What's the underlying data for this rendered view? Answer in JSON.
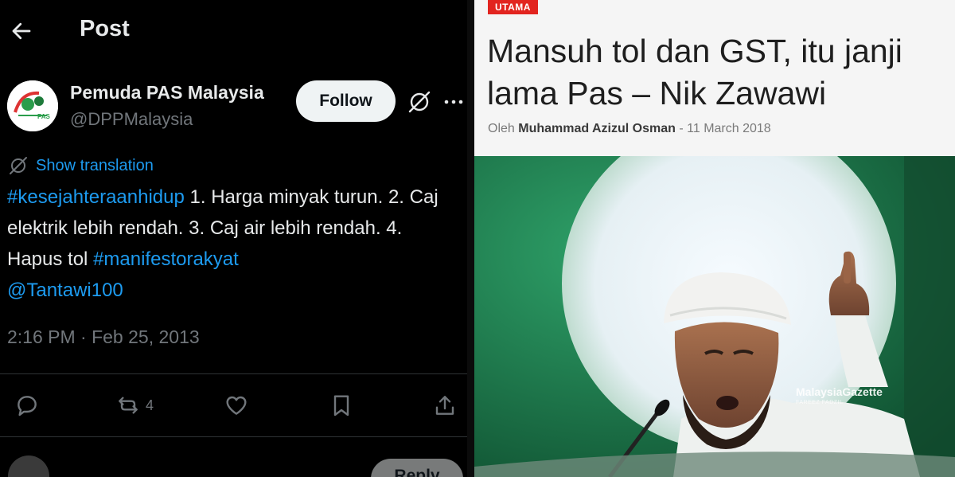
{
  "tweet": {
    "header_title": "Post",
    "author": {
      "display_name": "Pemuda PAS Malaysia",
      "handle": "@DPPMalaysia"
    },
    "follow_label": "Follow",
    "translate_label": "Show translation",
    "body": {
      "hashtag1": "#kesejahteraanhidup",
      "text1": " 1. Harga minyak turun. 2. Caj elektrik lebih rendah. 3. Caj air lebih rendah. 4. Hapus tol ",
      "hashtag2": "#manifestorakyat",
      "mention": "@Tantawi100"
    },
    "timestamp": "2:16 PM · Feb 25, 2013",
    "actions": {
      "retweet_count": "4"
    },
    "reply_button_label": "Reply",
    "icons": [
      "back-arrow-icon",
      "grok-icon",
      "more-icon",
      "translate-icon",
      "reply-icon",
      "retweet-icon",
      "like-icon",
      "bookmark-icon",
      "share-icon"
    ],
    "colors": {
      "background": "#000000",
      "text": "#e7e9ea",
      "muted": "#71767b",
      "link": "#1d9bf0"
    }
  },
  "article": {
    "category": "UTAMA",
    "headline": "Mansuh tol dan GST, itu janji lama Pas – Nik Zawawi",
    "byline_prefix": "Oleh",
    "author": "Muhammad Azizul Osman",
    "separator": "-",
    "date": "11 March 2018",
    "photo_watermark": "MalaysiaGazette",
    "photo_credit": "FAREEZ FADZIL",
    "colors": {
      "badge": "#e2241f",
      "headline": "#1e1e1e",
      "background": "#f5f5f5"
    }
  }
}
